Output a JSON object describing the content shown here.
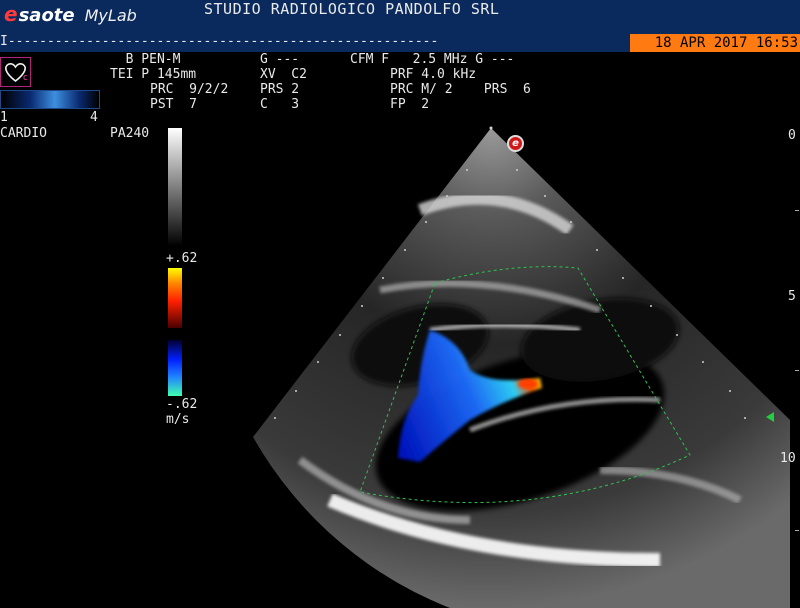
{
  "header": {
    "brand_e": "e",
    "brand_saote": "saote",
    "brand_mylab": "MyLab",
    "studio_name": "STUDIO RADIOLOGICO PANDOLFO SRL",
    "cursor_line": "I-------------------------------------------------------",
    "datetime": "18 APR 2017 16:53"
  },
  "params": {
    "row1_a": "  B PEN-M",
    "row1_b": "G ---",
    "row1_c": "CFM F   2.5 MHz G ---",
    "row2_a": "TEI P 145mm",
    "row2_b": "XV  C2",
    "row2_c": "PRF 4.0 kHz",
    "row3_a": "PRC  9/2/2",
    "row3_b": "PRS 2",
    "row3_c": "PRC M/ 2    PRS  6",
    "row4_a": "PST  7",
    "row4_b": "C   3",
    "row4_c": "FP  2"
  },
  "left_panel": {
    "heart_c": "c",
    "probe_range_min": "1",
    "probe_range_max": "4",
    "preset": "CARDIO",
    "probe": "PA240",
    "scale_top": "+.62",
    "scale_bottom": "-.62",
    "scale_unit": "m/s"
  },
  "depth_labels": [
    "0",
    "5",
    "10"
  ],
  "marker_letter": "e",
  "colors": {
    "header_bg": "#0a2a5e",
    "date_bg": "#ff7a10",
    "color_box": "#40c060",
    "brand_red": "#ff3a3a"
  }
}
